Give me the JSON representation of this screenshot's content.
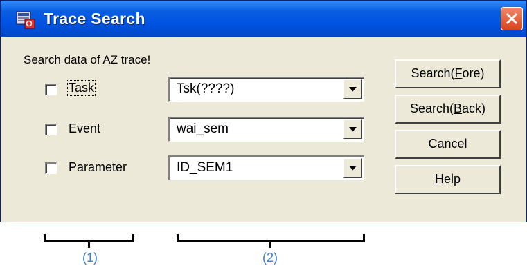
{
  "window": {
    "title": "Trace Search",
    "close_icon": "close-icon"
  },
  "instruction": "Search data of AZ trace!",
  "criteria": [
    {
      "label": "Task",
      "checked": false,
      "value": "Tsk(????)"
    },
    {
      "label": "Event",
      "checked": false,
      "value": "wai_sem"
    },
    {
      "label": "Parameter",
      "checked": false,
      "value": "ID_SEM1"
    }
  ],
  "buttons": {
    "search_fore": {
      "before": "Search(",
      "key": "F",
      "after": "ore)"
    },
    "search_back": {
      "before": "Search(",
      "key": "B",
      "after": "ack)"
    },
    "cancel": {
      "before": "",
      "key": "C",
      "after": "ancel"
    },
    "help": {
      "before": "",
      "key": "H",
      "after": "elp"
    }
  },
  "annotations": {
    "checkbox_column": "(1)",
    "combo_column": "(2)"
  },
  "colors": {
    "titlebar": "#0054e3",
    "close_button": "#d9431c",
    "dialog_bg": "#ece9d8",
    "callout": "#3a7cc8"
  }
}
